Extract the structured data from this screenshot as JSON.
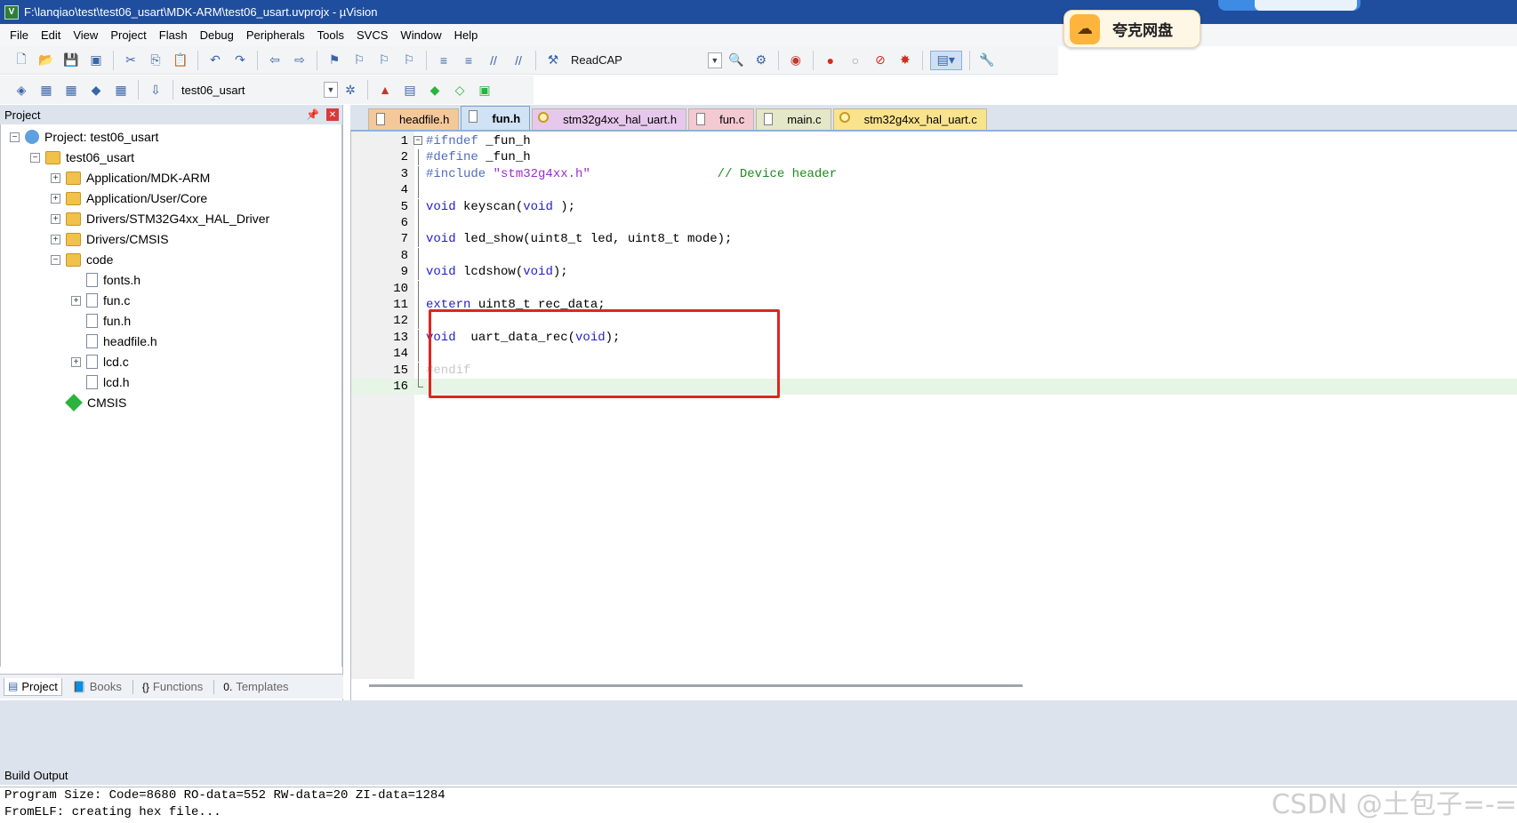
{
  "window": {
    "title": "F:\\lanqiao\\test\\test06_usart\\MDK-ARM\\test06_usart.uvprojx - µVision"
  },
  "cloud_widget": {
    "label": "夸克网盘"
  },
  "menu": [
    "File",
    "Edit",
    "View",
    "Project",
    "Flash",
    "Debug",
    "Peripherals",
    "Tools",
    "SVCS",
    "Window",
    "Help"
  ],
  "toolbar": {
    "readcap_label": "ReadCAP",
    "target_select": "test06_usart"
  },
  "project_panel": {
    "title": "Project",
    "tree": [
      {
        "label": "Project: test06_usart",
        "depth": 0,
        "expander": "−",
        "icon": "project-icon"
      },
      {
        "label": "test06_usart",
        "depth": 1,
        "expander": "−",
        "icon": "folder-icon"
      },
      {
        "label": "Application/MDK-ARM",
        "depth": 2,
        "expander": "+",
        "icon": "folder-icon"
      },
      {
        "label": "Application/User/Core",
        "depth": 2,
        "expander": "+",
        "icon": "folder-icon"
      },
      {
        "label": "Drivers/STM32G4xx_HAL_Driver",
        "depth": 2,
        "expander": "+",
        "icon": "folder-icon"
      },
      {
        "label": "Drivers/CMSIS",
        "depth": 2,
        "expander": "+",
        "icon": "folder-icon"
      },
      {
        "label": "code",
        "depth": 2,
        "expander": "−",
        "icon": "folder-icon"
      },
      {
        "label": "fonts.h",
        "depth": 3,
        "expander": "",
        "icon": "file-icon"
      },
      {
        "label": "fun.c",
        "depth": 3,
        "expander": "+",
        "icon": "file-icon"
      },
      {
        "label": "fun.h",
        "depth": 3,
        "expander": "",
        "icon": "file-icon"
      },
      {
        "label": "headfile.h",
        "depth": 3,
        "expander": "",
        "icon": "file-icon"
      },
      {
        "label": "lcd.c",
        "depth": 3,
        "expander": "+",
        "icon": "file-icon"
      },
      {
        "label": "lcd.h",
        "depth": 3,
        "expander": "",
        "icon": "file-icon"
      },
      {
        "label": "CMSIS",
        "depth": 2,
        "expander": "",
        "icon": "cmsis-diamond-icon"
      }
    ],
    "tabs": [
      "Project",
      "Books",
      "Functions",
      "Templates"
    ]
  },
  "editor": {
    "tabs": [
      "headfile.h",
      "fun.h",
      "stm32g4xx_hal_uart.h",
      "fun.c",
      "main.c",
      "stm32g4xx_hal_uart.c"
    ],
    "active_tab": "fun.h",
    "lines": [
      {
        "n": "1",
        "parts": [
          [
            "pp",
            "#ifndef"
          ],
          [
            "",
            " _fun_h"
          ]
        ]
      },
      {
        "n": "2",
        "parts": [
          [
            "pp",
            "#define"
          ],
          [
            "",
            " _fun_h"
          ]
        ]
      },
      {
        "n": "3",
        "parts": [
          [
            "pp",
            "#include"
          ],
          [
            "",
            " "
          ],
          [
            "str",
            "\"stm32g4xx.h\""
          ],
          [
            "",
            "                 "
          ],
          [
            "cmt",
            "// Device header"
          ]
        ]
      },
      {
        "n": "4",
        "parts": []
      },
      {
        "n": "5",
        "parts": [
          [
            "kw",
            "void"
          ],
          [
            "",
            " keyscan("
          ],
          [
            "kw",
            "void"
          ],
          [
            "",
            " );"
          ]
        ]
      },
      {
        "n": "6",
        "parts": []
      },
      {
        "n": "7",
        "parts": [
          [
            "kw",
            "void"
          ],
          [
            "",
            " led_show(uint8_t led, uint8_t mode);"
          ]
        ]
      },
      {
        "n": "8",
        "parts": []
      },
      {
        "n": "9",
        "parts": [
          [
            "kw",
            "void"
          ],
          [
            "",
            " lcdshow("
          ],
          [
            "kw",
            "void"
          ],
          [
            "",
            ");"
          ]
        ]
      },
      {
        "n": "10",
        "parts": []
      },
      {
        "n": "11",
        "parts": [
          [
            "kw",
            "extern"
          ],
          [
            "",
            " uint8_t rec_data;"
          ]
        ]
      },
      {
        "n": "12",
        "parts": []
      },
      {
        "n": "13",
        "parts": [
          [
            "kw",
            "void"
          ],
          [
            "",
            "  uart_data_rec("
          ],
          [
            "kw",
            "void"
          ],
          [
            "",
            ");"
          ]
        ]
      },
      {
        "n": "14",
        "parts": []
      },
      {
        "n": "15",
        "parts": [
          [
            "dimmed",
            "#endif"
          ]
        ]
      },
      {
        "n": "16",
        "parts": []
      }
    ]
  },
  "build_output": {
    "title": "Build Output",
    "lines": [
      "Program Size: Code=8680 RO-data=552 RW-data=20 ZI-data=1284",
      "FromELF: creating hex file..."
    ]
  },
  "watermark": "CSDN @土包子=-="
}
